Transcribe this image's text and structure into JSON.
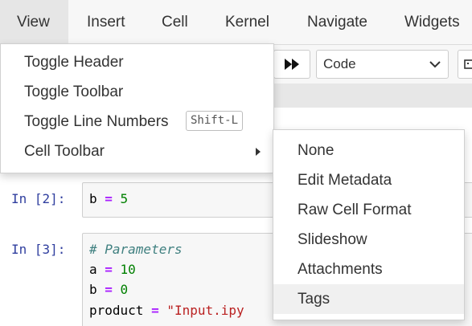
{
  "menubar": {
    "items": [
      {
        "label": "View",
        "active": true
      },
      {
        "label": "Insert"
      },
      {
        "label": "Cell"
      },
      {
        "label": "Kernel"
      },
      {
        "label": "Navigate"
      },
      {
        "label": "Widgets"
      }
    ]
  },
  "toolbar": {
    "cell_type": "Code",
    "icons": [
      "fast-forward-icon",
      "keyboard-icon"
    ]
  },
  "view_menu": {
    "items": [
      {
        "label": "Toggle Header"
      },
      {
        "label": "Toggle Toolbar"
      },
      {
        "label": "Toggle Line Numbers",
        "shortcut": "Shift-L"
      },
      {
        "label": "Cell Toolbar",
        "has_submenu": true
      }
    ]
  },
  "cell_toolbar_submenu": {
    "items": [
      {
        "label": "None"
      },
      {
        "label": "Edit Metadata"
      },
      {
        "label": "Raw Cell Format"
      },
      {
        "label": "Slideshow"
      },
      {
        "label": "Attachments"
      },
      {
        "label": "Tags",
        "highlighted": true
      }
    ]
  },
  "cells": [
    {
      "prompt": "In [2]:",
      "lines": [
        [
          {
            "t": "b "
          },
          {
            "t": "=",
            "c": "op"
          },
          {
            "t": " "
          },
          {
            "t": "5",
            "c": "num"
          }
        ]
      ]
    },
    {
      "prompt": "In [3]:",
      "lines": [
        [
          {
            "t": "# Parameters",
            "c": "com"
          }
        ],
        [
          {
            "t": "a "
          },
          {
            "t": "=",
            "c": "op"
          },
          {
            "t": " "
          },
          {
            "t": "10",
            "c": "num"
          }
        ],
        [
          {
            "t": "b "
          },
          {
            "t": "=",
            "c": "op"
          },
          {
            "t": " "
          },
          {
            "t": "0",
            "c": "num"
          }
        ],
        [
          {
            "t": "product "
          },
          {
            "t": "=",
            "c": "op"
          },
          {
            "t": " "
          },
          {
            "t": "\"Input.ipy",
            "c": "str"
          }
        ]
      ]
    }
  ],
  "colors": {
    "prompt": "#303f9f",
    "operator": "#aa22ff",
    "number": "#008000",
    "comment": "#408080",
    "string": "#ba2121"
  }
}
